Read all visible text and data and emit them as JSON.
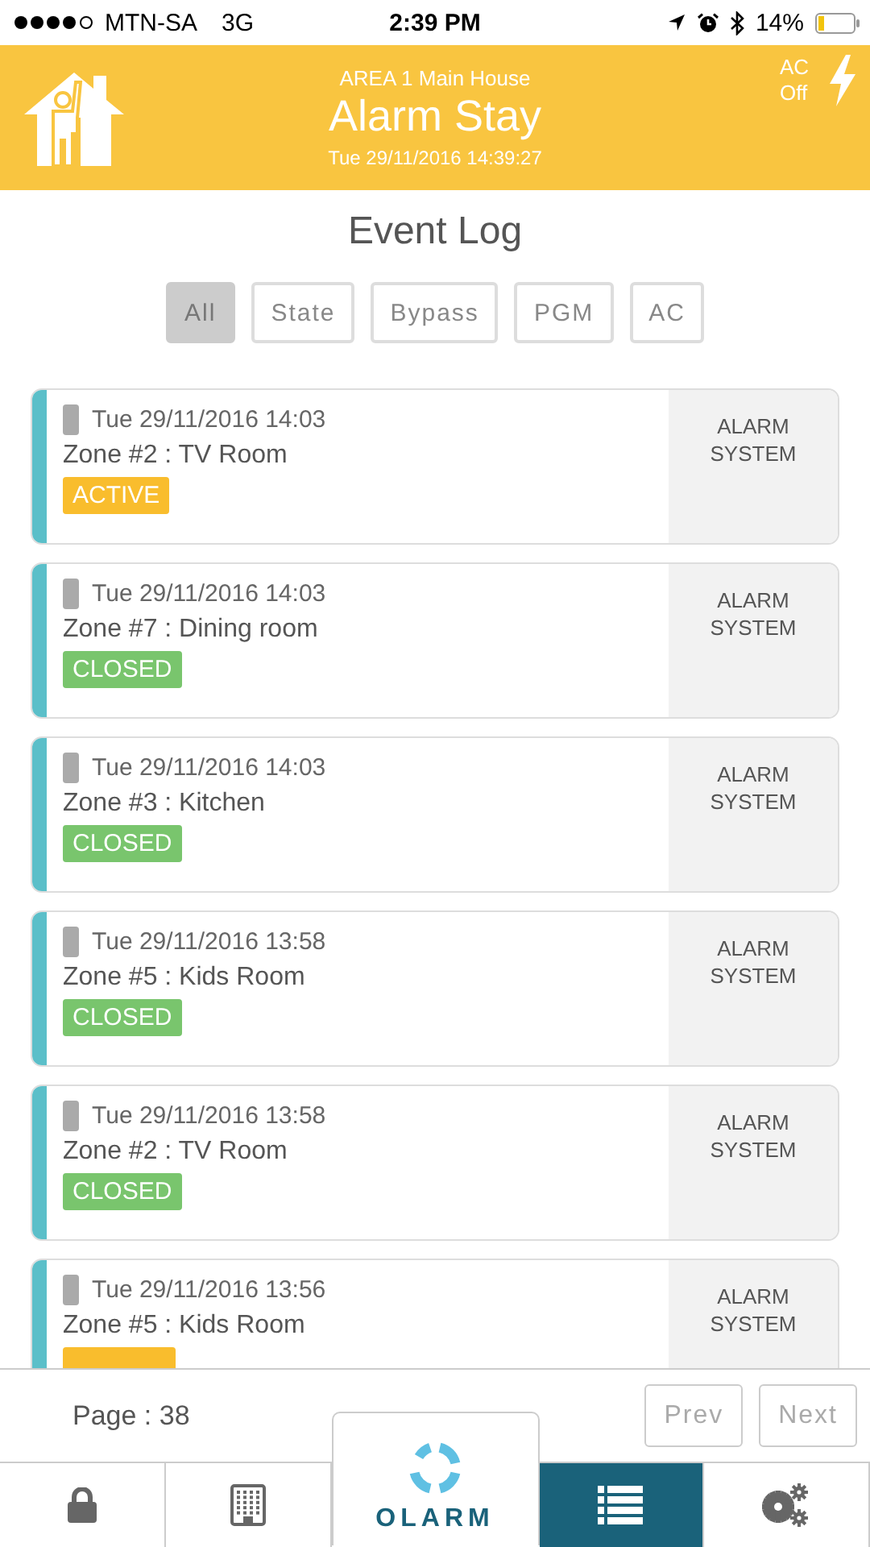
{
  "status_bar": {
    "carrier": "MTN-SA",
    "network": "3G",
    "time": "2:39 PM",
    "battery": "14%"
  },
  "header": {
    "area": "AREA 1 Main House",
    "mode": "Alarm Stay",
    "datetime": "Tue 29/11/2016 14:39:27",
    "ac_status": "AC Off"
  },
  "title": "Event Log",
  "filters": [
    {
      "label": "All",
      "selected": true
    },
    {
      "label": "State",
      "selected": false
    },
    {
      "label": "Bypass",
      "selected": false
    },
    {
      "label": "PGM",
      "selected": false
    },
    {
      "label": "AC",
      "selected": false
    }
  ],
  "events": [
    {
      "time": "Tue 29/11/2016 14:03",
      "zone": "Zone #2 : TV Room",
      "status": "ACTIVE",
      "color": "#f9bd2d",
      "source": "ALARM SYSTEM"
    },
    {
      "time": "Tue 29/11/2016 14:03",
      "zone": "Zone #7 : Dining room",
      "status": "CLOSED",
      "color": "#79c56d",
      "source": "ALARM SYSTEM"
    },
    {
      "time": "Tue 29/11/2016 14:03",
      "zone": "Zone #3 : Kitchen",
      "status": "CLOSED",
      "color": "#79c56d",
      "source": "ALARM SYSTEM"
    },
    {
      "time": "Tue 29/11/2016 13:58",
      "zone": "Zone #5 : Kids Room",
      "status": "CLOSED",
      "color": "#79c56d",
      "source": "ALARM SYSTEM"
    },
    {
      "time": "Tue 29/11/2016 13:58",
      "zone": "Zone #2 : TV Room",
      "status": "CLOSED",
      "color": "#79c56d",
      "source": "ALARM SYSTEM"
    },
    {
      "time": "Tue 29/11/2016 13:56",
      "zone": "Zone #5 : Kids Room",
      "color": "#f9bd2d",
      "source": "ALARM SYSTEM"
    }
  ],
  "pagination": {
    "page": "Page : 38",
    "prev": "Prev",
    "next": "Next"
  },
  "nav": [
    {
      "kind": "lock",
      "selected": false
    },
    {
      "kind": "building",
      "selected": false
    },
    {
      "kind": "logo",
      "label": "OLARM",
      "selected": false
    },
    {
      "kind": "list",
      "selected": true
    },
    {
      "kind": "settings",
      "selected": false
    }
  ]
}
